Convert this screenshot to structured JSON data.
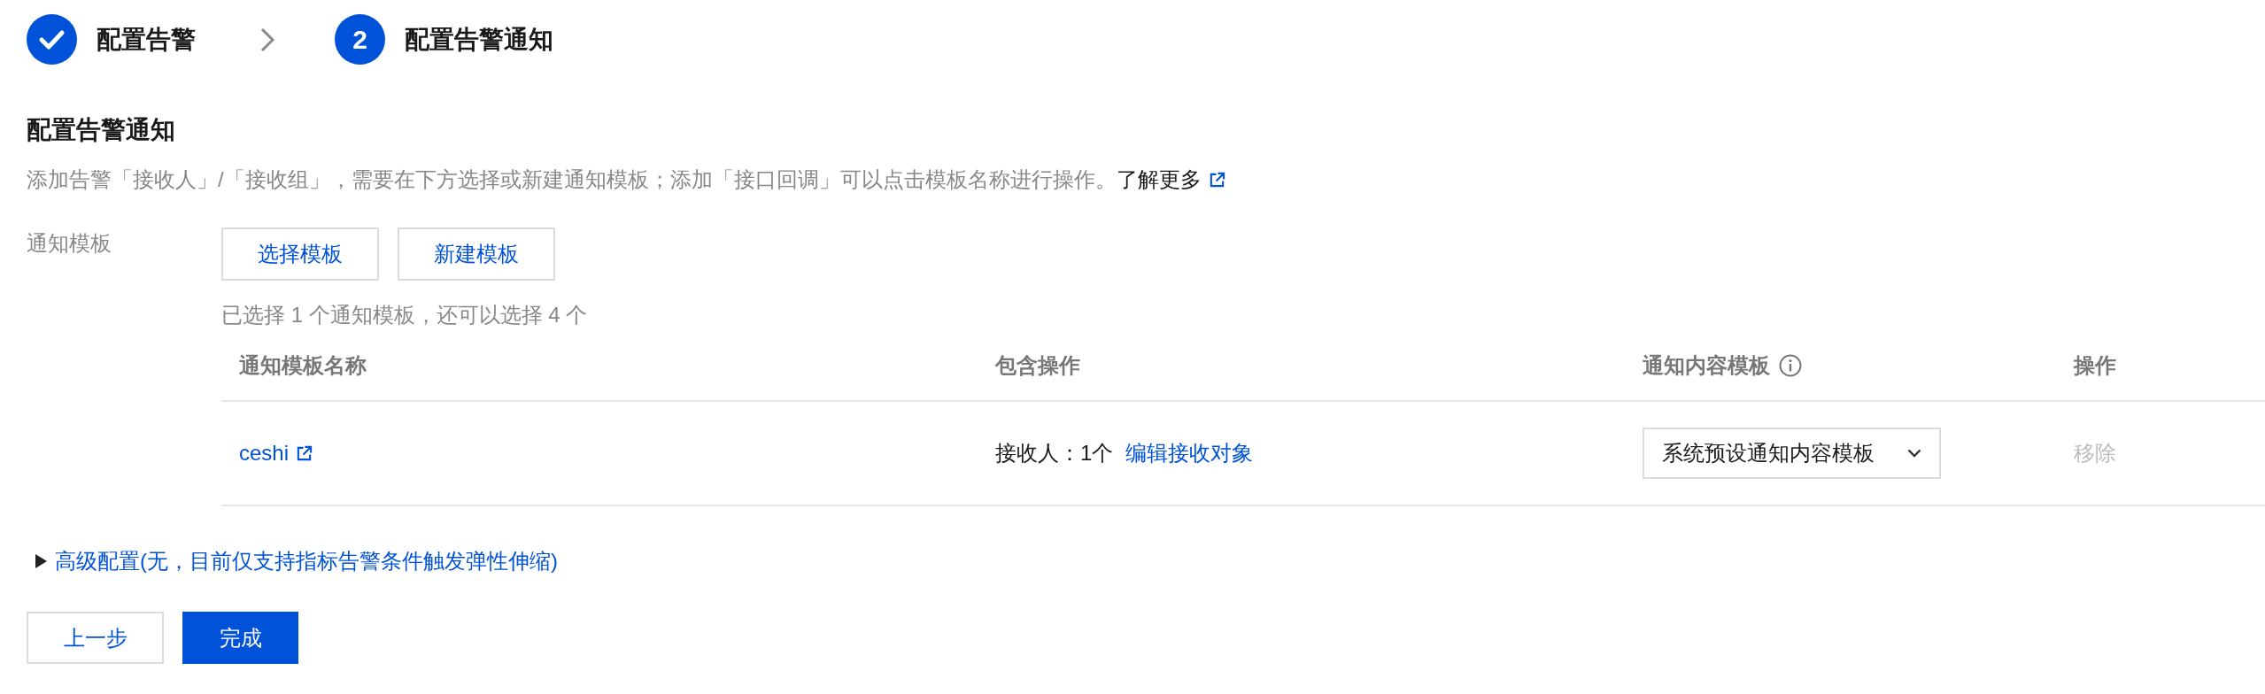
{
  "steps": [
    {
      "label": "配置告警",
      "completed": true
    },
    {
      "number": "2",
      "label": "配置告警通知",
      "completed": false
    }
  ],
  "section": {
    "title": "配置告警通知",
    "description": "添加告警「接收人」/「接收组」，需要在下方选择或新建通知模板；添加「接口回调」可以点击模板名称进行操作。",
    "learn_more": "了解更多"
  },
  "template_field": {
    "label": "通知模板",
    "buttons": [
      "选择模板",
      "新建模板"
    ],
    "selection_hint": "已选择 1 个通知模板，还可以选择 4 个",
    "table": {
      "columns": [
        {
          "title": "通知模板名称",
          "info": false
        },
        {
          "title": "包含操作",
          "info": false
        },
        {
          "title": "通知内容模板",
          "info": true
        },
        {
          "title": "操作",
          "info": false
        }
      ],
      "rows": [
        {
          "name": "ceshi",
          "recipients": "接收人：1个",
          "edit_link": "编辑接收对象",
          "content_template": "系统预设通知内容模板",
          "remove": {
            "label": "移除",
            "disabled": true
          }
        }
      ]
    }
  },
  "advanced": {
    "label": "高级配置(无，目前仅支持指标告警条件触发弹性伸缩)",
    "expanded": false
  },
  "actions": [
    {
      "label": "上一步",
      "kind": "secondary"
    },
    {
      "label": "完成",
      "kind": "primary"
    }
  ]
}
